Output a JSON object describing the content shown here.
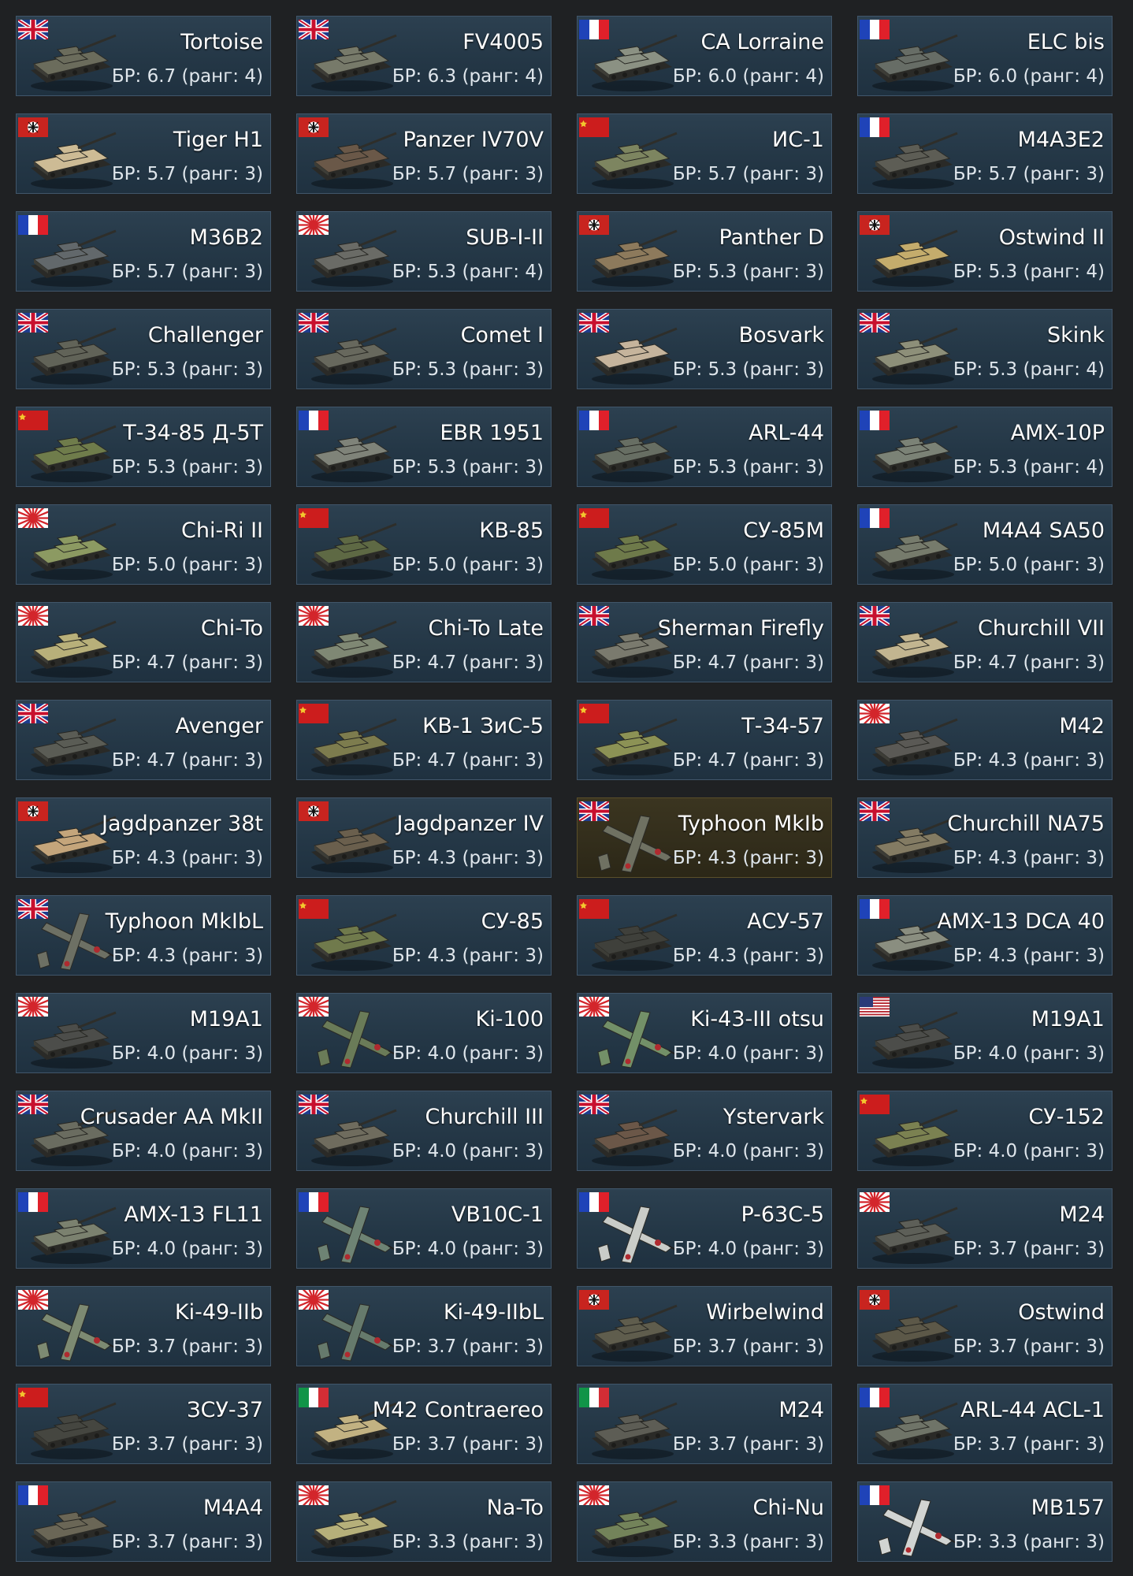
{
  "br_prefix": "БР:",
  "rank_word": "ранг:",
  "colors": {
    "background": "#1f2123",
    "card": "#243746",
    "card_border": "#41566a",
    "card_highlight": "#322d1b",
    "text": "#ffffff"
  },
  "vehicles": [
    {
      "name": "Tortoise",
      "br": "6.7",
      "rank": "4",
      "nation": "uk",
      "type": "tank",
      "camo": "#6b6c5c"
    },
    {
      "name": "FV4005",
      "br": "6.3",
      "rank": "4",
      "nation": "uk",
      "type": "tank",
      "camo": "#777a6a"
    },
    {
      "name": "CA Lorraine",
      "br": "6.0",
      "rank": "4",
      "nation": "france",
      "type": "tank",
      "camo": "#8b9183"
    },
    {
      "name": "ELC bis",
      "br": "6.0",
      "rank": "4",
      "nation": "france",
      "type": "tank",
      "camo": "#676d66"
    },
    {
      "name": "Tiger H1",
      "br": "5.7",
      "rank": "3",
      "nation": "germany",
      "type": "tank",
      "camo": "#cdbb95"
    },
    {
      "name": "Panzer IV70V",
      "br": "5.7",
      "rank": "3",
      "nation": "germany",
      "type": "tank",
      "camo": "#6a5848"
    },
    {
      "name": "ИС-1",
      "br": "5.7",
      "rank": "3",
      "nation": "ussr",
      "type": "tank",
      "camo": "#7d8560"
    },
    {
      "name": "M4A3E2",
      "br": "5.7",
      "rank": "3",
      "nation": "france",
      "type": "tank",
      "camo": "#5d5d55"
    },
    {
      "name": "M36B2",
      "br": "5.7",
      "rank": "3",
      "nation": "france",
      "type": "tank",
      "camo": "#62686b"
    },
    {
      "name": "SUB-I-II",
      "br": "5.3",
      "rank": "4",
      "nation": "japan",
      "type": "tank",
      "camo": "#6a6b66"
    },
    {
      "name": "Panther D",
      "br": "5.3",
      "rank": "3",
      "nation": "germany",
      "type": "tank",
      "camo": "#8d7a5c"
    },
    {
      "name": "Ostwind II",
      "br": "5.3",
      "rank": "4",
      "nation": "germany",
      "type": "tank",
      "camo": "#c4ac6c"
    },
    {
      "name": "Challenger",
      "br": "5.3",
      "rank": "3",
      "nation": "uk",
      "type": "tank",
      "camo": "#616358"
    },
    {
      "name": "Comet I",
      "br": "5.3",
      "rank": "3",
      "nation": "uk",
      "type": "tank",
      "camo": "#67685d"
    },
    {
      "name": "Bosvark",
      "br": "5.3",
      "rank": "3",
      "nation": "uk",
      "type": "tank",
      "camo": "#c5b49c"
    },
    {
      "name": "Skink",
      "br": "5.3",
      "rank": "4",
      "nation": "uk",
      "type": "tank",
      "camo": "#8d8f79"
    },
    {
      "name": "Т-34-85 Д-5Т",
      "br": "5.3",
      "rank": "3",
      "nation": "ussr",
      "type": "tank",
      "camo": "#6f7c4b"
    },
    {
      "name": "EBR 1951",
      "br": "5.3",
      "rank": "3",
      "nation": "france",
      "type": "tank",
      "camo": "#7f8379"
    },
    {
      "name": "ARL-44",
      "br": "5.3",
      "rank": "3",
      "nation": "france",
      "type": "tank",
      "camo": "#676e63"
    },
    {
      "name": "AMX-10P",
      "br": "5.3",
      "rank": "4",
      "nation": "france",
      "type": "tank",
      "camo": "#7b8276"
    },
    {
      "name": "Chi-Ri II",
      "br": "5.0",
      "rank": "3",
      "nation": "japan",
      "type": "tank",
      "camo": "#8c9a62"
    },
    {
      "name": "КВ-85",
      "br": "5.0",
      "rank": "3",
      "nation": "ussr",
      "type": "tank",
      "camo": "#5e6944"
    },
    {
      "name": "СУ-85М",
      "br": "5.0",
      "rank": "3",
      "nation": "ussr",
      "type": "tank",
      "camo": "#6e7a4a"
    },
    {
      "name": "M4A4 SA50",
      "br": "5.0",
      "rank": "3",
      "nation": "france",
      "type": "tank",
      "camo": "#767b6c"
    },
    {
      "name": "Chi-To",
      "br": "4.7",
      "rank": "3",
      "nation": "japan",
      "type": "tank",
      "camo": "#b8b07a"
    },
    {
      "name": "Chi-To Late",
      "br": "4.7",
      "rank": "3",
      "nation": "japan",
      "type": "tank",
      "camo": "#7f8874"
    },
    {
      "name": "Sherman Firefly",
      "br": "4.7",
      "rank": "3",
      "nation": "uk",
      "type": "tank",
      "camo": "#7a7a6e"
    },
    {
      "name": "Churchill VII",
      "br": "4.7",
      "rank": "3",
      "nation": "uk",
      "type": "tank",
      "camo": "#c2b590"
    },
    {
      "name": "Avenger",
      "br": "4.7",
      "rank": "3",
      "nation": "uk",
      "type": "tank",
      "camo": "#5a5c55"
    },
    {
      "name": "КВ-1 ЗиС-5",
      "br": "4.7",
      "rank": "3",
      "nation": "ussr",
      "type": "tank",
      "camo": "#7d7c4e"
    },
    {
      "name": "Т-34-57",
      "br": "4.7",
      "rank": "3",
      "nation": "ussr",
      "type": "tank",
      "camo": "#8c9255"
    },
    {
      "name": "M42",
      "br": "4.3",
      "rank": "3",
      "nation": "japan",
      "type": "tank",
      "camo": "#5a5955"
    },
    {
      "name": "Jagdpanzer 38t",
      "br": "4.3",
      "rank": "3",
      "nation": "germany",
      "type": "tank",
      "camo": "#c4a57b"
    },
    {
      "name": "Jagdpanzer IV",
      "br": "4.3",
      "rank": "3",
      "nation": "germany",
      "type": "tank",
      "camo": "#6a5f4d"
    },
    {
      "name": "Typhoon MkIb",
      "br": "4.3",
      "rank": "3",
      "nation": "uk",
      "type": "plane",
      "camo": "#6f7162",
      "highlight": true
    },
    {
      "name": "Churchill NA75",
      "br": "4.3",
      "rank": "3",
      "nation": "uk",
      "type": "tank",
      "camo": "#837b63"
    },
    {
      "name": "Typhoon MkIbL",
      "br": "4.3",
      "rank": "3",
      "nation": "uk",
      "type": "plane",
      "camo": "#6d7064"
    },
    {
      "name": "СУ-85",
      "br": "4.3",
      "rank": "3",
      "nation": "ussr",
      "type": "tank",
      "camo": "#707a4c"
    },
    {
      "name": "АСУ-57",
      "br": "4.3",
      "rank": "3",
      "nation": "ussr",
      "type": "tank",
      "camo": "#3f403b"
    },
    {
      "name": "AMX-13 DCA 40",
      "br": "4.3",
      "rank": "3",
      "nation": "france",
      "type": "tank",
      "camo": "#8a8e80"
    },
    {
      "name": "M19A1",
      "br": "4.0",
      "rank": "3",
      "nation": "japan",
      "type": "tank",
      "camo": "#4c4d4a"
    },
    {
      "name": "Ki-100",
      "br": "4.0",
      "rank": "3",
      "nation": "japan",
      "type": "plane",
      "camo": "#6a7b58"
    },
    {
      "name": "Ki-43-III otsu",
      "br": "4.0",
      "rank": "3",
      "nation": "japan",
      "type": "plane",
      "camo": "#739068"
    },
    {
      "name": "M19A1",
      "br": "4.0",
      "rank": "3",
      "nation": "usa",
      "type": "tank",
      "camo": "#4c4d4a"
    },
    {
      "name": "Crusader AA MkII",
      "br": "4.0",
      "rank": "3",
      "nation": "uk",
      "type": "tank",
      "camo": "#6a6c60"
    },
    {
      "name": "Churchill III",
      "br": "4.0",
      "rank": "3",
      "nation": "uk",
      "type": "tank",
      "camo": "#6f6c5e"
    },
    {
      "name": "Ystervark",
      "br": "4.0",
      "rank": "3",
      "nation": "uk",
      "type": "tank",
      "camo": "#6b5748"
    },
    {
      "name": "СУ-152",
      "br": "4.0",
      "rank": "3",
      "nation": "ussr",
      "type": "tank",
      "camo": "#7b8151"
    },
    {
      "name": "AMX-13 FL11",
      "br": "4.0",
      "rank": "3",
      "nation": "france",
      "type": "tank",
      "camo": "#7b816f"
    },
    {
      "name": "VB10C-1",
      "br": "4.0",
      "rank": "3",
      "nation": "france",
      "type": "plane",
      "camo": "#6e8374"
    },
    {
      "name": "P-63C-5",
      "br": "4.0",
      "rank": "3",
      "nation": "france",
      "type": "plane",
      "camo": "#c9ccc8"
    },
    {
      "name": "M24",
      "br": "3.7",
      "rank": "3",
      "nation": "japan",
      "type": "tank",
      "camo": "#5d5f58"
    },
    {
      "name": "Ki-49-IIb",
      "br": "3.7",
      "rank": "3",
      "nation": "japan",
      "type": "plane",
      "camo": "#7d8a72"
    },
    {
      "name": "Ki-49-IIbL",
      "br": "3.7",
      "rank": "3",
      "nation": "japan",
      "type": "plane",
      "camo": "#667a6c"
    },
    {
      "name": "Wirbelwind",
      "br": "3.7",
      "rank": "3",
      "nation": "germany",
      "type": "tank",
      "camo": "#5f5d4d"
    },
    {
      "name": "Ostwind",
      "br": "3.7",
      "rank": "3",
      "nation": "germany",
      "type": "tank",
      "camo": "#5c5848"
    },
    {
      "name": "ЗСУ-37",
      "br": "3.7",
      "rank": "3",
      "nation": "ussr",
      "type": "tank",
      "camo": "#454640"
    },
    {
      "name": "M42 Contraereo",
      "br": "3.7",
      "rank": "3",
      "nation": "italy",
      "type": "tank",
      "camo": "#c2b282"
    },
    {
      "name": "M24",
      "br": "3.7",
      "rank": "3",
      "nation": "italy",
      "type": "tank",
      "camo": "#5d5d55"
    },
    {
      "name": "ARL-44 ACL-1",
      "br": "3.7",
      "rank": "3",
      "nation": "france",
      "type": "tank",
      "camo": "#6f7468"
    },
    {
      "name": "M4A4",
      "br": "3.7",
      "rank": "3",
      "nation": "france",
      "type": "tank",
      "camo": "#6a6656"
    },
    {
      "name": "Na-To",
      "br": "3.3",
      "rank": "3",
      "nation": "japan",
      "type": "tank",
      "camo": "#b6b07a"
    },
    {
      "name": "Chi-Nu",
      "br": "3.3",
      "rank": "3",
      "nation": "japan",
      "type": "tank",
      "camo": "#73835a"
    },
    {
      "name": "MB157",
      "br": "3.3",
      "rank": "3",
      "nation": "france",
      "type": "plane",
      "camo": "#d1d4d2"
    }
  ]
}
